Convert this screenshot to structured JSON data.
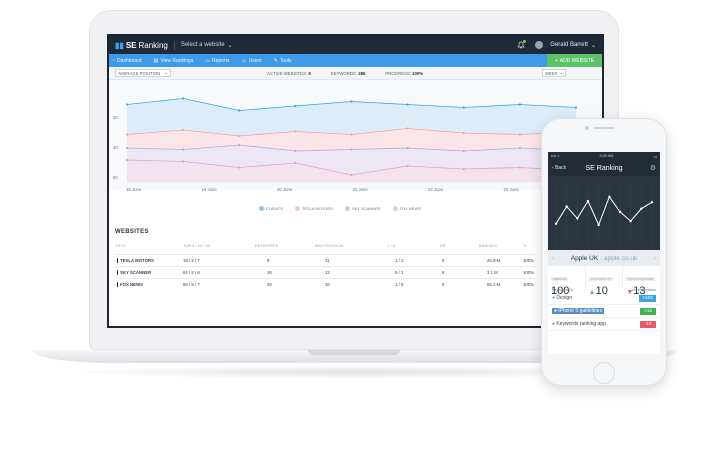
{
  "app": {
    "brand_prefix": "SE",
    "brand_name": "Ranking",
    "site_selector": "Select a website",
    "user_name": "Gerald Barrett"
  },
  "nav": {
    "items": [
      {
        "icon": "dashboard-icon",
        "label": "Dashboard"
      },
      {
        "icon": "rankings-icon",
        "label": "View Rankings"
      },
      {
        "icon": "reports-icon",
        "label": "Reports"
      },
      {
        "icon": "users-icon",
        "label": "Users"
      },
      {
        "icon": "tools-icon",
        "label": "Tools"
      }
    ],
    "add_website": "ADD WEBSITE"
  },
  "filters": {
    "metric": "AVERAGE POSITION",
    "active_websites_label": "ACTIVE WEBSITES:",
    "active_websites": "9",
    "keywords_label": "KEYWORDS:",
    "keywords": "286",
    "progress_label": "PROGRESS:",
    "progress": "100%",
    "period": "WEEK"
  },
  "chart_data": {
    "type": "area",
    "x": [
      "16 June",
      "19 June",
      "20 June",
      "21 June",
      "22 June",
      "23 June"
    ],
    "y_ticks": [
      "20",
      "40",
      "60"
    ],
    "ylim": [
      0,
      60
    ],
    "series": [
      {
        "name": "CLIENTS",
        "color": "#3aa3e3",
        "values": [
          11,
          7,
          15,
          12,
          9,
          11,
          13,
          11,
          13
        ]
      },
      {
        "name": "TESLA MOTORS",
        "color": "#f0a0a8",
        "values": [
          31,
          28,
          32,
          29,
          31,
          27,
          30,
          31,
          29
        ]
      },
      {
        "name": "SKY SCANNER",
        "color": "#b9a7d6",
        "values": [
          40,
          41,
          38,
          42,
          41,
          40,
          42,
          40,
          42
        ]
      },
      {
        "name": "FOX NEWS",
        "color": "#d7a4c8",
        "values": [
          48,
          49,
          53,
          50,
          58,
          52,
          54,
          53,
          55
        ]
      }
    ]
  },
  "websites": {
    "title": "WEBSITES",
    "columns": [
      "TITLE",
      "TOP 5 / 10 / 30",
      "KEYWORDS",
      "AVG POSITION",
      "1 / 4",
      "PR",
      "INDEXED",
      "%"
    ],
    "rows": [
      {
        "name": "TESLA MOTORS",
        "top": "19 / 2 / 7",
        "keywords": "9",
        "avg": "11",
        "ratio": "1 / 2",
        "pr": "8",
        "indexed": "25.9 M",
        "pct": "100%"
      },
      {
        "name": "SKY SCANNER",
        "top": "84 / 2 / 6",
        "keywords": "26",
        "avg": "12",
        "ratio": "5 / 1",
        "pr": "8",
        "indexed": "3.1 M",
        "pct": "100%"
      },
      {
        "name": "FOX NEWS",
        "top": "55 / 5 / 7",
        "keywords": "26",
        "avg": "10",
        "ratio": "1 / 9",
        "pr": "8",
        "indexed": "55.2 M",
        "pct": "100%"
      }
    ]
  },
  "phone": {
    "time": "9:00 AM",
    "back": "Back",
    "title": "SE Ranking",
    "site": "Apple UK",
    "site_domain": "apple.co.uk",
    "metrics": [
      {
        "label": "AVERAGE",
        "value": "100",
        "dir": ""
      },
      {
        "label": "POSITIONS UP",
        "value": "10",
        "dir": "up"
      },
      {
        "label": "POSITIONS DOWN",
        "value": "13",
        "dir": "down"
      }
    ],
    "keywords_count": "Keywords (3)",
    "current_position": "current position",
    "keywords": [
      {
        "label": "Design",
        "badge": ">100",
        "color": "blue"
      },
      {
        "label": "iPhone 5 guidelines",
        "badge": "+12",
        "color": "green"
      },
      {
        "label": "Keywords ranking app",
        "badge": "-14",
        "color": "red"
      }
    ],
    "chart_values": [
      30,
      62,
      40,
      72,
      28,
      80,
      52,
      35,
      58,
      70
    ]
  }
}
